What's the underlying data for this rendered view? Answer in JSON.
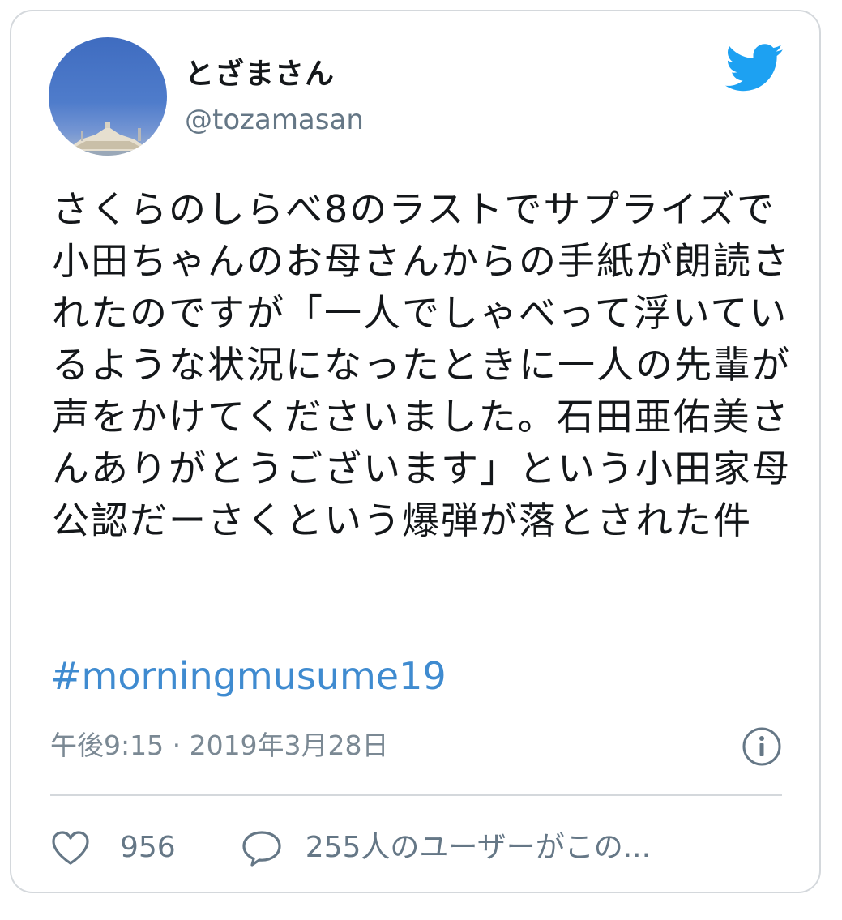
{
  "user": {
    "display_name": "とざまさん",
    "handle": "@tozamasan"
  },
  "tweet": {
    "text": "さくらのしらべ8のラストでサプライズで小田ちゃんのお母さんからの手紙が朗読されたのですが「一人でしゃべって浮いているような状況になったときに一人の先輩が声をかけてくださいました。石田亜佑美さんありがとうございます」という小田家母公認だーさくという爆弾が落とされた件",
    "hashtag": "#morningmusume19",
    "timestamp": "午後9:15 · 2019年3月28日"
  },
  "actions": {
    "like_count": "956",
    "reply_text": "255人のユーザーがこの..."
  },
  "icons": {
    "brand": "twitter-bird-icon",
    "info": "info-icon",
    "like": "heart-icon",
    "reply": "speech-bubble-icon"
  },
  "colors": {
    "twitter_blue": "#1da1f2",
    "hashtag": "#3f8bd0",
    "text": "#14171a",
    "secondary_text": "#657786"
  }
}
